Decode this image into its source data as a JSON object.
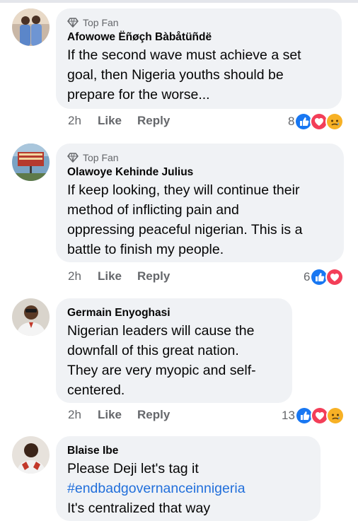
{
  "comments": [
    {
      "badge": "Top Fan",
      "author": "Afowowe Ëñøçh Bàbåtüñdë",
      "lines": [
        "If the second wave must achieve a set",
        "goal, then Nigeria youths should be",
        "prepare for the worse..."
      ],
      "time": "2h",
      "like": "Like",
      "reply": "Reply",
      "reaction_count": "8",
      "reactions": [
        "like-icon",
        "love-icon",
        "sad-icon"
      ]
    },
    {
      "badge": "Top Fan",
      "author": "Olawoye Kehinde Julius",
      "lines": [
        "If keep looking, they will continue their",
        "method of inflicting pain and",
        "oppressing peaceful nigerian. This is a",
        "battle to finish my people."
      ],
      "time": "2h",
      "like": "Like",
      "reply": "Reply",
      "reaction_count": "6",
      "reactions": [
        "like-icon",
        "love-icon"
      ]
    },
    {
      "author": "Germain Enyoghasi",
      "lines": [
        "Nigerian leaders will cause the",
        "downfall of this great nation.",
        "They are very myopic and self-",
        "centered."
      ],
      "time": "2h",
      "like": "Like",
      "reply": "Reply",
      "reaction_count": "13",
      "reactions": [
        "like-icon",
        "love-icon",
        "sad-icon"
      ]
    },
    {
      "author": "Blaise Ibe",
      "line1": "Please Deji let's tag it",
      "hashtag": "#endbadgovernanceinnigeria",
      "line3": "It's centralized that way"
    }
  ],
  "colors": {
    "like": "#1877f2",
    "love": "#f33e58",
    "sad": "#f7b125",
    "hashtag": "#216fdb"
  }
}
